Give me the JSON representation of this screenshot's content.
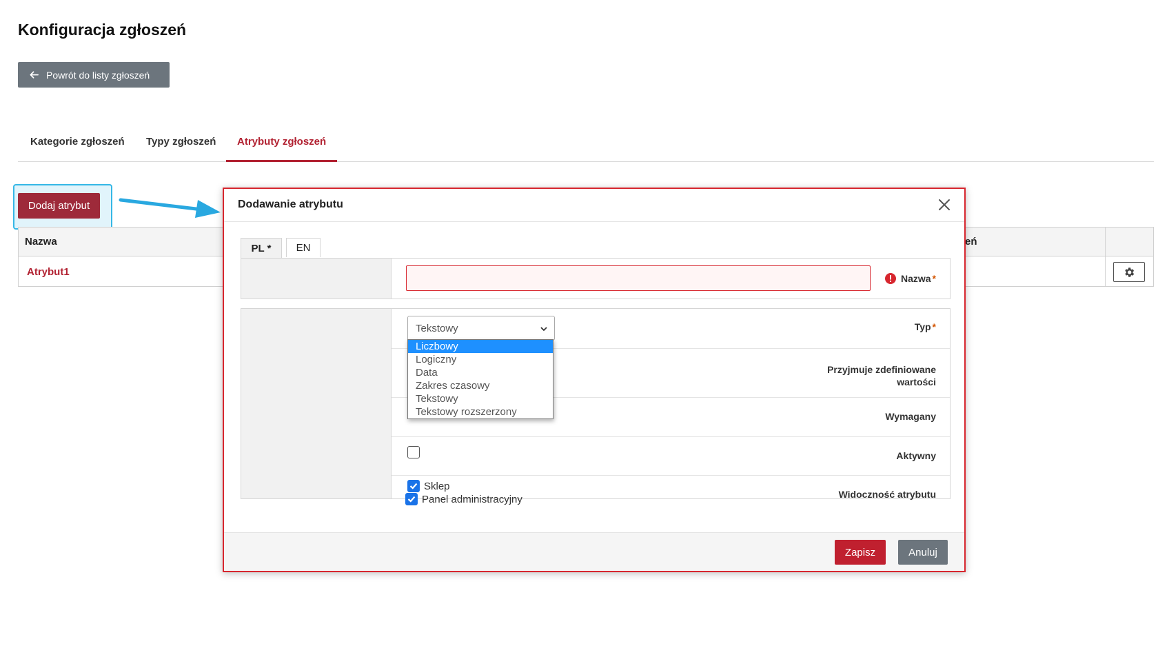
{
  "page": {
    "title": "Konfiguracja zgłoszeń",
    "back_button": "Powrót do listy zgłoszeń"
  },
  "tabs": [
    {
      "label": "Kategorie zgłoszeń",
      "active": false
    },
    {
      "label": "Typy zgłoszeń",
      "active": false
    },
    {
      "label": "Atrybuty zgłoszeń",
      "active": true
    }
  ],
  "add_button": "Dodaj atrybut",
  "table": {
    "header_name": "Nazwa",
    "header_tail": "eń",
    "rows": [
      {
        "name": "Atrybut1"
      }
    ]
  },
  "modal": {
    "title": "Dodawanie atrybutu",
    "lang_tabs": [
      "PL *",
      "EN"
    ],
    "fields": {
      "name_label": "Nazwa",
      "name_value": "",
      "type_label": "Typ",
      "type_value": "Tekstowy",
      "predefined_label_1": "Przyjmuje zdefiniowane",
      "predefined_label_2": "wartości",
      "required_label": "Wymagany",
      "active_label": "Aktywny",
      "visibility_label": "Widoczność atrybutu",
      "visibility_options": [
        {
          "label": "Sklep",
          "checked": true
        },
        {
          "label": "Panel administracyjny",
          "checked": true
        }
      ]
    },
    "required_marker": "*",
    "type_options": [
      "Liczbowy",
      "Logiczny",
      "Data",
      "Zakres czasowy",
      "Tekstowy",
      "Tekstowy rozszerzony"
    ],
    "type_highlighted": "Liczbowy",
    "save": "Zapisz",
    "cancel": "Anuluj"
  },
  "colors": {
    "accent": "#b22232",
    "modal_border": "#d7262e",
    "highlight": "#35b7e6",
    "secondary": "#6c757d"
  }
}
